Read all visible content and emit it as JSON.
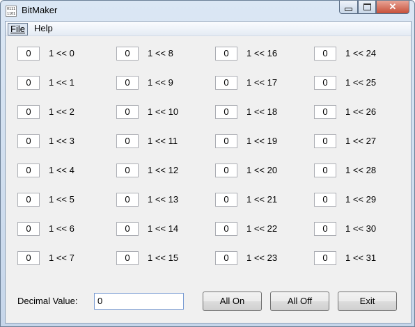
{
  "window": {
    "title": "BitMaker",
    "icon_text": "0111 1101"
  },
  "menu": [
    {
      "label": "File"
    },
    {
      "label": "Help"
    }
  ],
  "bits": [
    {
      "value": "0",
      "label": "1 << 0"
    },
    {
      "value": "0",
      "label": "1 << 1"
    },
    {
      "value": "0",
      "label": "1 << 2"
    },
    {
      "value": "0",
      "label": "1 << 3"
    },
    {
      "value": "0",
      "label": "1 << 4"
    },
    {
      "value": "0",
      "label": "1 << 5"
    },
    {
      "value": "0",
      "label": "1 << 6"
    },
    {
      "value": "0",
      "label": "1 << 7"
    },
    {
      "value": "0",
      "label": "1 << 8"
    },
    {
      "value": "0",
      "label": "1 << 9"
    },
    {
      "value": "0",
      "label": "1 << 10"
    },
    {
      "value": "0",
      "label": "1 << 11"
    },
    {
      "value": "0",
      "label": "1 << 12"
    },
    {
      "value": "0",
      "label": "1 << 13"
    },
    {
      "value": "0",
      "label": "1 << 14"
    },
    {
      "value": "0",
      "label": "1 << 15"
    },
    {
      "value": "0",
      "label": "1 << 16"
    },
    {
      "value": "0",
      "label": "1 << 17"
    },
    {
      "value": "0",
      "label": "1 << 18"
    },
    {
      "value": "0",
      "label": "1 << 19"
    },
    {
      "value": "0",
      "label": "1 << 20"
    },
    {
      "value": "0",
      "label": "1 << 21"
    },
    {
      "value": "0",
      "label": "1 << 22"
    },
    {
      "value": "0",
      "label": "1 << 23"
    },
    {
      "value": "0",
      "label": "1 << 24"
    },
    {
      "value": "0",
      "label": "1 << 25"
    },
    {
      "value": "0",
      "label": "1 << 26"
    },
    {
      "value": "0",
      "label": "1 << 27"
    },
    {
      "value": "0",
      "label": "1 << 28"
    },
    {
      "value": "0",
      "label": "1 << 29"
    },
    {
      "value": "0",
      "label": "1 << 30"
    },
    {
      "value": "0",
      "label": "1 << 31"
    }
  ],
  "decimal": {
    "label": "Decimal Value:",
    "value": "0"
  },
  "buttons": {
    "all_on": "All On",
    "all_off": "All Off",
    "exit": "Exit"
  }
}
